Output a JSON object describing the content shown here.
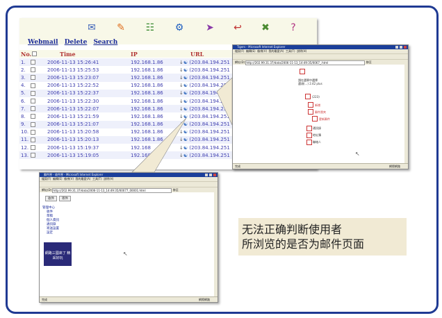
{
  "toolbar_icons": [
    "inbox-icon",
    "compose-icon",
    "address-book-icon",
    "settings-icon",
    "forward-icon",
    "reply-icon",
    "trash-icon",
    "help-icon"
  ],
  "links": {
    "webmail": "Webmail",
    "delete": "Delete",
    "search": "Search"
  },
  "columns": {
    "no": "No.",
    "time": "Time",
    "ip": "IP",
    "url": "URL"
  },
  "rows": [
    {
      "no": "1.",
      "time": "2006-11-13 15:26:41",
      "ip": "192.168.1.86",
      "url": " (203.84.194.251"
    },
    {
      "no": "2.",
      "time": "2006-11-13 15:25:53",
      "ip": "192.168.1.86",
      "url": " (203.84.194.251"
    },
    {
      "no": "3.",
      "time": "2006-11-13 15:23:07",
      "ip": "192.168.1.86",
      "url": " (203.84.194.251"
    },
    {
      "no": "4.",
      "time": "2006-11-13 15:22:52",
      "ip": "192.168.1.86",
      "url": " (203.84.194.251"
    },
    {
      "no": "5.",
      "time": "2006-11-13 15:22:37",
      "ip": "192.168.1.86",
      "url": " (203.84.194.251"
    },
    {
      "no": "6.",
      "time": "2006-11-13 15:22:30",
      "ip": "192.168.1.86",
      "url": " (203.84.194.251"
    },
    {
      "no": "7.",
      "time": "2006-11-13 15:22:07",
      "ip": "192.168.1.86",
      "url": " (203.84.194.251"
    },
    {
      "no": "8.",
      "time": "2006-11-13 15:21:59",
      "ip": "192.168.1.86",
      "url": " (203.84.194.251"
    },
    {
      "no": "9.",
      "time": "2006-11-13 15:21:07",
      "ip": "192.168.1.86",
      "url": " (203.84.194.251"
    },
    {
      "no": "10.",
      "time": "2006-11-13 15:20:58",
      "ip": "192.168.1.86",
      "url": " (203.84.194.251"
    },
    {
      "no": "11.",
      "time": "2006-11-13 15:20:13",
      "ip": "192.168.1.86",
      "url": " (203.84.194.251"
    },
    {
      "no": "12.",
      "time": "2006-11-13 15:19:37",
      "ip": "192.168",
      "url": " (203.84.194.251"
    },
    {
      "no": "13.",
      "time": "2006-11-13 15:19:05",
      "ip": "192.168",
      "url": " (203.84.194.251"
    }
  ],
  "browser_right": {
    "title": "Tigers - Microsoft Internet Explorer",
    "menu": "檔案(F)  編輯(E)  檢視(V)  我的最愛(A)  工具(T)  說明(H)",
    "address_label": "網址(D)",
    "address": "http://202.99.31.37/data/2006-11-13_14:49:35/0067_.html",
    "go": "移至",
    "status": "完成",
    "zone": "網際網路",
    "content_lines": [
      "請在選單中選擇",
      "選項(...) 2.42 plus",
      "(223)",
      "新增",
      "郵件匣夾",
      "更新郵件",
      "通訊錄",
      "地址簿",
      "聯絡人"
    ]
  },
  "browser_left": {
    "title": "郵件匣 - 收件匣 - Microsoft Internet Explorer",
    "menu": "檔案(F)  編輯(E)  檢視(V)  我的最愛(A)  工具(T)  說明(H)",
    "address_label": "網址(D)",
    "address": "http://202.99.31.37/data/2006-11-13_14:49:35/00077_00001.html",
    "go": "移至",
    "status": "完成",
    "zone": "網際網路",
    "tabs": [
      "收件",
      "寄件"
    ],
    "tree": [
      "管理中心",
      "收件",
      "草稿",
      "個人資訊",
      "通訊錄",
      "寄送設置",
      "設定"
    ],
    "ad_text": "網路三國來了 精采好玩"
  },
  "note_lines": [
    "无法正确判断使用者",
    "所浏览的是否为邮件页面"
  ]
}
